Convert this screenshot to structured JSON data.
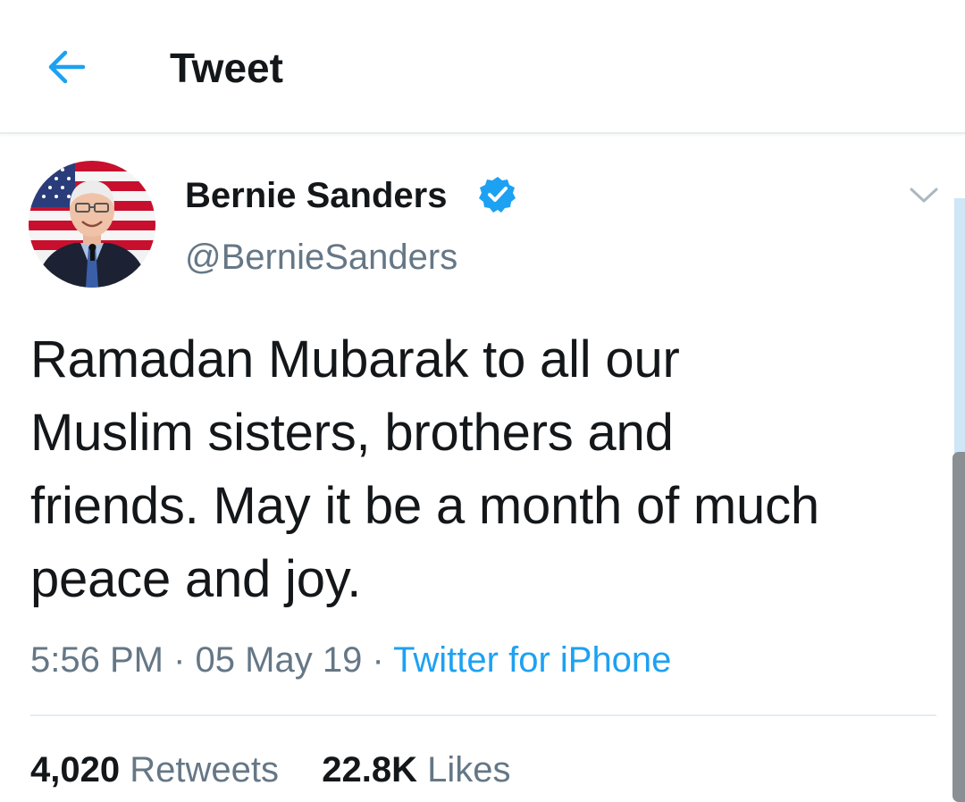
{
  "header": {
    "title": "Tweet",
    "back_icon": "arrow-left-icon",
    "accent_color": "#1da1f2"
  },
  "tweet": {
    "author": {
      "name": "Bernie Sanders",
      "handle": "@BernieSanders",
      "verified": true,
      "verified_icon": "verified-badge-icon"
    },
    "menu_icon": "chevron-down-icon",
    "text": "Ramadan Mubarak to all our Muslim sisters, brothers and friends. May it be a month of much peace and joy.",
    "time": "5:56 PM",
    "separator": "·",
    "date": "05 May 19",
    "source": "Twitter for iPhone",
    "stats": {
      "retweets_count": "4,020",
      "retweets_label": "Retweets",
      "likes_count": "22.8K",
      "likes_label": "Likes"
    }
  },
  "colors": {
    "text_primary": "#14171a",
    "text_secondary": "#657786",
    "link": "#1da1f2",
    "divider": "#e6ecf0"
  }
}
